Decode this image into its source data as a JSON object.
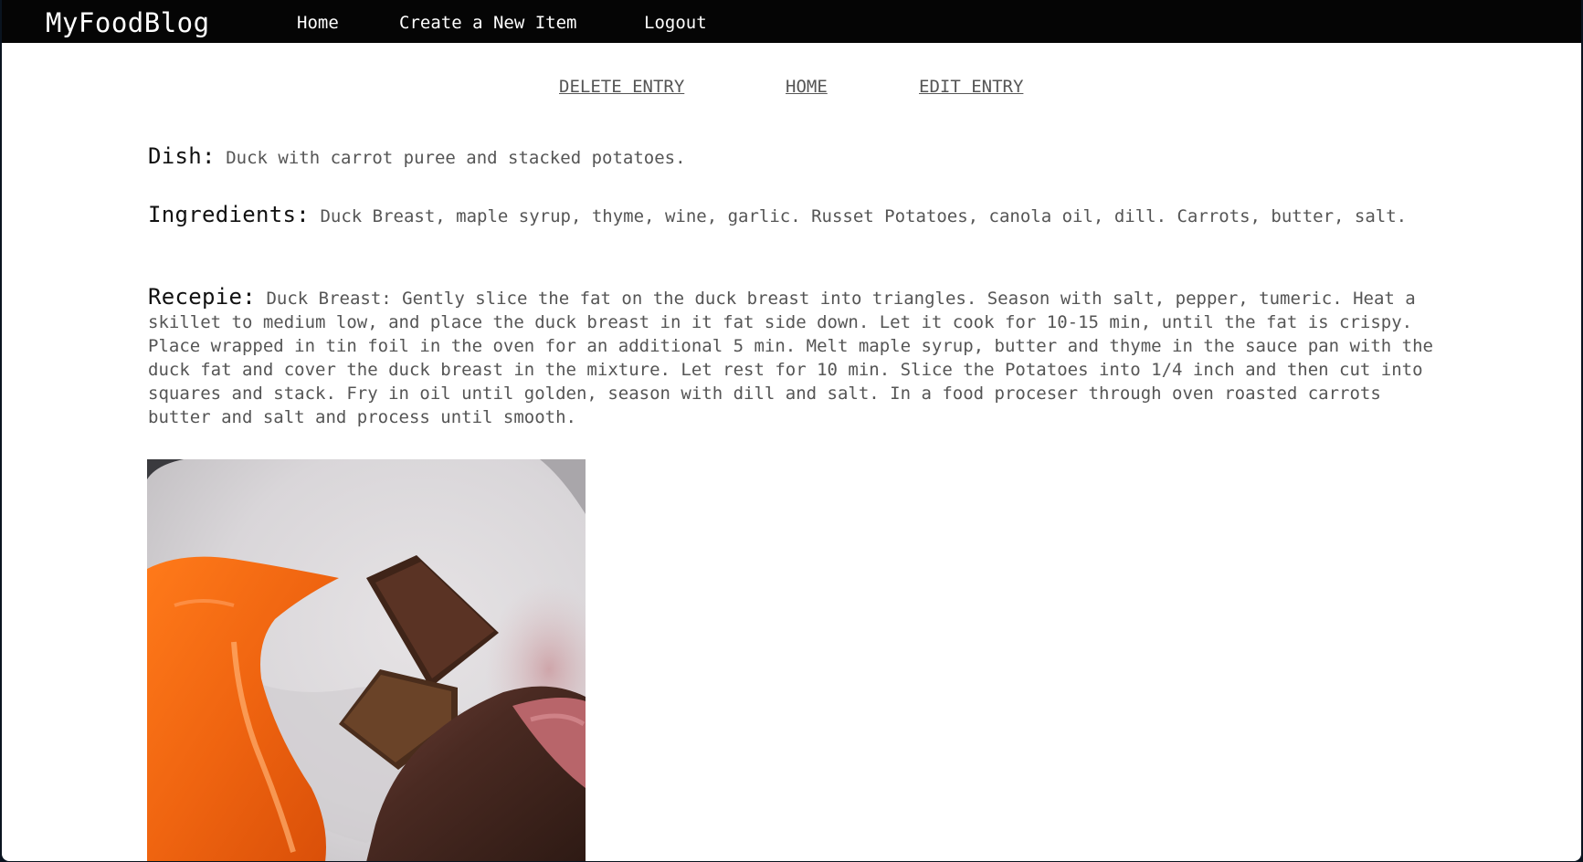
{
  "navbar": {
    "brand": "MyFoodBlog",
    "links": [
      "Home",
      "Create a New Item",
      "Logout"
    ]
  },
  "actions": {
    "delete_label": "DELETE ENTRY",
    "home_label": "HOME",
    "edit_label": "EDIT ENTRY"
  },
  "entry": {
    "dish_label": "Dish:",
    "dish_value": "Duck with carrot puree and stacked potatoes.",
    "ingredients_label": "Ingredients:",
    "ingredients_value": "Duck Breast, maple syrup, thyme, wine, garlic. Russet Potatoes, canola oil, dill. Carrots, butter, salt.",
    "recipe_label": "Recepie:",
    "recipe_value": "Duck Breast: Gently slice the fat on the duck breast into triangles. Season with salt, pepper, tumeric. Heat a skillet to medium low, and place the duck breast in it fat side down. Let it cook for 10-15 min, until the fat is crispy. Place wrapped in tin foil in the oven for an additional 5 min. Melt maple syrup, butter and thyme in the sauce pan with the duck fat and cover the duck breast in the mixture. Let rest for 10 min. Slice the Potatoes into 1/4 inch and then cut into squares and stack. Fry in oil until golden, season with dill and salt. In a food proceser through oven roasted carrots butter and salt and process until smooth."
  },
  "colors": {
    "navbar_bg": "#050505",
    "nav_text": "#ffffff",
    "body_text": "#555555",
    "label_text": "#111111",
    "page_bg": "#ffffff"
  }
}
